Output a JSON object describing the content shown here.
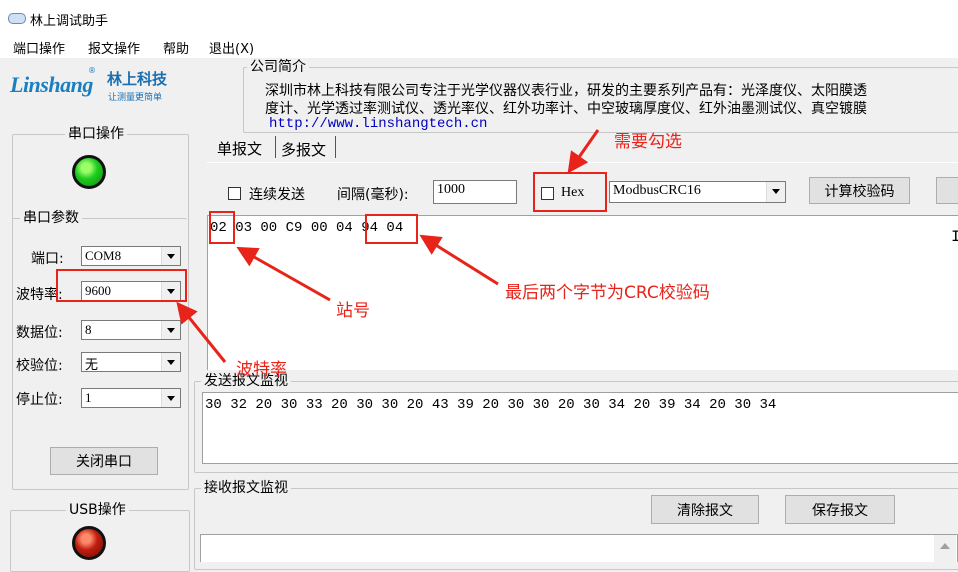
{
  "window": {
    "title": "林上调试助手"
  },
  "menu": [
    "端口操作",
    "报文操作",
    "帮助",
    "退出(X)"
  ],
  "logo": {
    "brand_en": "Linshang",
    "registered": "®",
    "brand_cn": "林上科技",
    "slogan": "让测量更简单"
  },
  "company": {
    "group_title": "公司简介",
    "line1": "深圳市林上科技有限公司专注于光学仪器仪表行业，研发的主要系列产品有：光泽度仪、太阳膜透",
    "line2": "度计、光学透过率测试仪、透光率仪、红外功率计、中空玻璃厚度仪、红外油墨测试仪、真空镀膜",
    "url": "http://www.linshangtech.cn"
  },
  "serial": {
    "group_title": "串口操作",
    "params_title": "串口参数",
    "port_label": "端口:",
    "port_value": "COM8",
    "baud_label": "波特率:",
    "baud_value": "9600",
    "databits_label": "数据位:",
    "databits_value": "8",
    "parity_label": "校验位:",
    "parity_value": "无",
    "stopbits_label": "停止位:",
    "stopbits_value": "1",
    "close_button": "关闭串口"
  },
  "usb": {
    "group_title": "USB操作"
  },
  "tabs": [
    "单报文",
    "多报文"
  ],
  "toolbar": {
    "continuous_label": "连续发送",
    "interval_label": "间隔(毫秒):",
    "interval_value": "1000",
    "hex_label": "Hex",
    "crc_mode": "ModbusCRC16",
    "calc_button": "计算校验码"
  },
  "message": {
    "text": "02 03 00 C9 00 04 94 04"
  },
  "send_monitor": {
    "title": "发送报文监视",
    "text": "30 32 20 30 33 20 30 30 20 43 39 20 30 30 20 30 34 20 39 34 20 30 34"
  },
  "recv_monitor": {
    "title": "接收报文监视",
    "clear_button": "清除报文",
    "save_button": "保存报文"
  },
  "annotations": {
    "hex_note": "需要勾选",
    "crc_note": "最后两个字节为CRC校验码",
    "station_note": "站号",
    "baud_note": "波特率",
    "color": "#e8231a"
  }
}
